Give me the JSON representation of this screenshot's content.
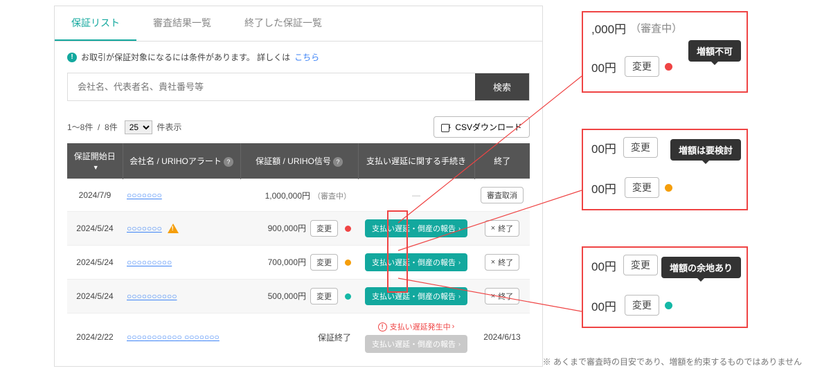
{
  "tabs": [
    "保証リスト",
    "審査結果一覧",
    "終了した保証一覧"
  ],
  "notice": {
    "text": "お取引が保証対象になるには条件があります。 詳しくは",
    "link": "こちら"
  },
  "search": {
    "placeholder": "会社名、代表者名、貴社番号等",
    "button": "検索"
  },
  "toolbar": {
    "range": "1〜8件",
    "sep": "/",
    "total": "8件",
    "per_page": "25",
    "suffix": "件表示",
    "csv": "CSVダウンロード"
  },
  "headers": {
    "start": "保証開始日",
    "company": "会社名 / URIHOアラート",
    "amount": "保証額 / URIHO信号",
    "delay": "支払い遅延に関する手続き",
    "end": "終了"
  },
  "rows": [
    {
      "date": "2024/7/9",
      "company": "○○○○○○○",
      "alert": false,
      "amount": "1,000,000円",
      "amount_note": "（審査中）",
      "change": false,
      "signal": "",
      "delay_btn": "",
      "end_btn": "審査取消",
      "end_date": ""
    },
    {
      "date": "2024/5/24",
      "company": "○○○○○○○",
      "alert": true,
      "amount": "900,000円",
      "amount_note": "",
      "change": true,
      "signal": "red",
      "delay_btn": "支払い遅延・倒産の報告",
      "end_btn": "終了",
      "end_date": ""
    },
    {
      "date": "2024/5/24",
      "company": "○○○○○○○○○",
      "alert": false,
      "amount": "700,000円",
      "amount_note": "",
      "change": true,
      "signal": "orange",
      "delay_btn": "支払い遅延・倒産の報告",
      "end_btn": "終了",
      "end_date": ""
    },
    {
      "date": "2024/5/24",
      "company": "○○○○○○○○○○",
      "alert": false,
      "amount": "500,000円",
      "amount_note": "",
      "change": true,
      "signal": "teal",
      "delay_btn": "支払い遅延・倒産の報告",
      "end_btn": "終了",
      "end_date": ""
    },
    {
      "date": "2024/2/22",
      "company": "○○○○○○○○○○○ ○○○○○○○",
      "alert": false,
      "amount": "保証終了",
      "amount_note": "",
      "change": false,
      "signal": "",
      "delay_btn": "支払い遅延・倒産の報告",
      "delay_warn": "支払い遅延発生中",
      "end_btn": "",
      "end_date": "2024/6/13"
    }
  ],
  "change_label": "変更",
  "end_x_label": "終了",
  "dash": "—",
  "callouts": [
    {
      "top_amount": ",000円",
      "top_note": "（審査中）",
      "row2_amount": "00円",
      "tooltip": "増額不可",
      "color": "red"
    },
    {
      "top_amount": "00円",
      "top_note": "",
      "row2_amount": "00円",
      "tooltip": "増額は要検討",
      "color": "orange"
    },
    {
      "top_amount": "00円",
      "top_note": "",
      "row2_amount": "00円",
      "tooltip": "増額の余地あり",
      "color": "teal"
    }
  ],
  "disclaimer": "※ あくまで審査時の目安であり、増額を約束するものではありません"
}
